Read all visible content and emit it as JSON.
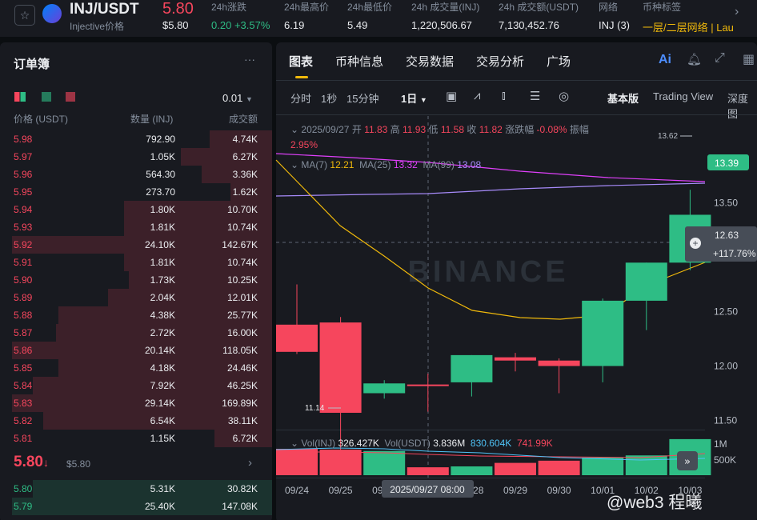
{
  "header": {
    "pair": "INJ/USDT",
    "price": "5.80",
    "sub": "Injective价格",
    "price_usd": "$5.80",
    "stats": [
      {
        "label": "24h涨跌",
        "value": "0.20",
        "pct": "+3.57%"
      },
      {
        "label": "24h最高价",
        "value": "6.19"
      },
      {
        "label": "24h最低价",
        "value": "5.49"
      },
      {
        "label": "24h 成交量(INJ)",
        "value": "1,220,506.67"
      },
      {
        "label": "24h 成交额(USDT)",
        "value": "7,130,452.76"
      },
      {
        "label": "网络",
        "value": "INJ (3)"
      },
      {
        "label": "币种标签",
        "value": "一层/二层网络 | Lau"
      }
    ]
  },
  "orderbook": {
    "title": "订单簿",
    "tick": "0.01",
    "cols": [
      "价格 (USDT)",
      "数量 (INJ)",
      "成交额"
    ],
    "asks": [
      [
        "5.98",
        "792.90",
        "4.74K",
        0.24
      ],
      [
        "5.97",
        "1.05K",
        "6.27K",
        0.35
      ],
      [
        "5.96",
        "564.30",
        "3.36K",
        0.27
      ],
      [
        "5.95",
        "273.70",
        "1.62K",
        0.16
      ],
      [
        "5.94",
        "1.80K",
        "10.70K",
        0.57
      ],
      [
        "5.93",
        "1.81K",
        "10.74K",
        0.57
      ],
      [
        "5.92",
        "24.10K",
        "142.67K",
        1.0
      ],
      [
        "5.91",
        "1.81K",
        "10.74K",
        0.57
      ],
      [
        "5.90",
        "1.73K",
        "10.25K",
        0.55
      ],
      [
        "5.89",
        "2.04K",
        "12.01K",
        0.63
      ],
      [
        "5.88",
        "4.38K",
        "25.77K",
        0.82
      ],
      [
        "5.87",
        "2.72K",
        "16.00K",
        0.83
      ],
      [
        "5.86",
        "20.14K",
        "118.05K",
        1.0
      ],
      [
        "5.85",
        "4.18K",
        "24.46K",
        0.82
      ],
      [
        "5.84",
        "7.92K",
        "46.25K",
        0.92
      ],
      [
        "5.83",
        "29.14K",
        "169.89K",
        1.0
      ],
      [
        "5.82",
        "6.54K",
        "38.11K",
        0.88
      ],
      [
        "5.81",
        "1.15K",
        "6.72K",
        0.22
      ]
    ],
    "mid": {
      "price": "5.80",
      "usd": "$5.80"
    },
    "bids": [
      [
        "5.80",
        "5.31K",
        "30.82K",
        0.92
      ],
      [
        "5.79",
        "25.40K",
        "147.08K",
        1.0
      ]
    ]
  },
  "chart_tabs": [
    "图表",
    "币种信息",
    "交易数据",
    "交易分析",
    "广场"
  ],
  "toolbar": {
    "intervals": [
      "分时",
      "1秒",
      "15分钟"
    ],
    "active": "1日",
    "modes": [
      "基本版",
      "Trading View",
      "深度图"
    ]
  },
  "ohlc": {
    "date": "2025/09/27",
    "o_label": "开",
    "o": "11.83",
    "h_label": "高",
    "h": "11.93",
    "l_label": "低",
    "l": "11.58",
    "c_label": "收",
    "c": "11.82",
    "chg_label": "涨跌幅",
    "chg": "-0.08%",
    "amp_label": "振幅",
    "amp": "2.95%"
  },
  "ma": {
    "ma7_label": "MA(7)",
    "ma7": "12.21",
    "ma25_label": "MA(25)",
    "ma25": "13.32",
    "ma99_label": "MA(99)",
    "ma99": "13.08"
  },
  "vol": {
    "label1": "Vol(INJ)",
    "v1": "326.427K",
    "label2": "Vol(USDT)",
    "v2": "3.836M",
    "v3": "830.604K",
    "v4": "741.99K"
  },
  "chart_data": {
    "type": "candlestick",
    "dates": [
      "09/24",
      "09/25",
      "09/26",
      "09/27",
      "09/28",
      "09/29",
      "09/30",
      "10/01",
      "10/02",
      "10/03"
    ],
    "open": [
      12.38,
      12.4,
      11.75,
      11.83,
      11.85,
      12.08,
      12.05,
      12.0,
      12.6,
      12.95
    ],
    "high": [
      12.75,
      12.45,
      11.87,
      11.93,
      12.1,
      12.12,
      12.07,
      12.62,
      12.95,
      13.62
    ],
    "low": [
      12.11,
      11.14,
      11.7,
      11.58,
      11.72,
      11.95,
      11.75,
      11.85,
      12.33,
      12.88
    ],
    "close": [
      12.13,
      11.57,
      11.84,
      11.82,
      12.1,
      12.05,
      12.0,
      12.6,
      12.95,
      13.39
    ],
    "volume": [
      0.6,
      0.58,
      0.55,
      0.18,
      0.2,
      0.28,
      0.33,
      0.4,
      0.45,
      0.82
    ],
    "ylim": [
      11.2,
      13.7
    ],
    "yticks": [
      "13.50",
      "13.00",
      "12.50",
      "12.00",
      "11.50"
    ],
    "vol_ticks": [
      "1M",
      "500K"
    ],
    "last": "13.39",
    "cross": {
      "price": "12.63",
      "pct": "+117.76%",
      "date": "2025/09/27 08:00"
    },
    "high_label": "13.62",
    "low_label": "11.14",
    "watermark": "BINANCE"
  },
  "watermark_text": "@web3 程曦"
}
